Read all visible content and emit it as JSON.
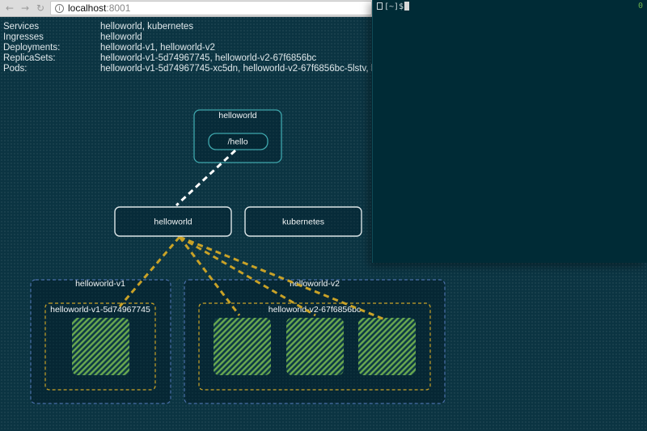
{
  "browser": {
    "url_host": "localhost",
    "url_port": ":8001"
  },
  "info": {
    "rows": [
      {
        "key": "Services",
        "value": "helloworld, kubernetes"
      },
      {
        "key": "Ingresses",
        "value": "helloworld"
      },
      {
        "key": "Deployments:",
        "value": "helloworld-v1, helloworld-v2"
      },
      {
        "key": "ReplicaSets:",
        "value": "helloworld-v1-5d74967745, helloworld-v2-67f6856bc"
      },
      {
        "key": "Pods:",
        "value": "helloworld-v1-5d74967745-xc5dn, helloworld-v2-67f6856bc-5lstv, h"
      }
    ]
  },
  "diagram": {
    "ingress": {
      "name": "helloworld",
      "path": "/hello"
    },
    "services": [
      "helloworld",
      "kubernetes"
    ],
    "deployments": [
      {
        "name": "helloworld-v1",
        "replicaset": "helloworld-v1-5d74967745",
        "pods": 1
      },
      {
        "name": "helloworld-v2",
        "replicaset": "helloworld-v2-67f6856bc",
        "pods": 3
      }
    ]
  },
  "terminal": {
    "prompt": "[~]$",
    "counter": "0"
  },
  "colors": {
    "background": "#0b3442",
    "ingress_border": "#3fa7ad",
    "service_border": "#dde6e8",
    "deployment_border": "#4a6fa8",
    "replicaset_border": "#c9a227",
    "link": "#c9a227",
    "pod_fill": "#6aa84f"
  }
}
